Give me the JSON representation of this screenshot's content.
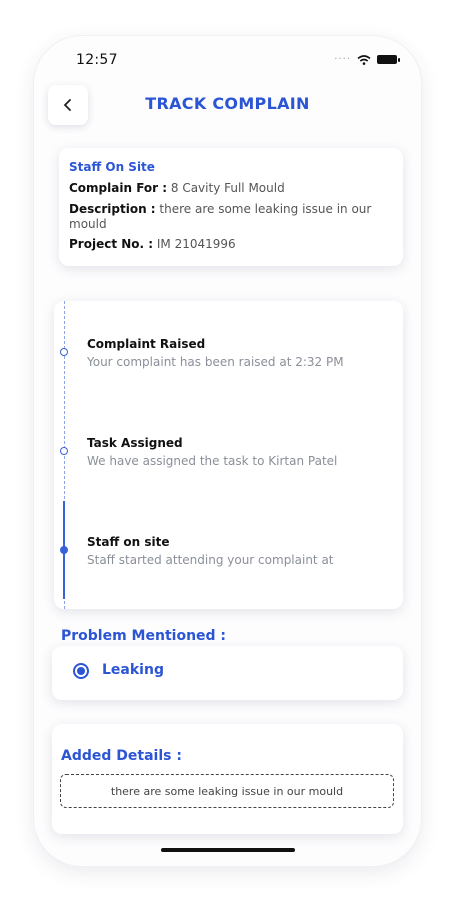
{
  "status_bar": {
    "time": "12:57"
  },
  "header": {
    "title": "TRACK COMPLAIN"
  },
  "info_card": {
    "site_label": "Staff On Site",
    "complain_for_label": "Complain For :",
    "complain_for_value": "8 Cavity Full Mould",
    "description_label": "Description :",
    "description_value": "there are some leaking issue in our mould",
    "project_label": "Project No. :",
    "project_value": "IM 21041996"
  },
  "timeline": [
    {
      "title": "Complaint Raised",
      "desc": "Your complaint has been raised at 2:32 PM"
    },
    {
      "title": "Task Assigned",
      "desc": "We have assigned the task to Kirtan Patel"
    },
    {
      "title": "Staff on site",
      "desc": "Staff started attending your complaint at"
    }
  ],
  "problem": {
    "label": "Problem Mentioned :",
    "option": "Leaking"
  },
  "details": {
    "label": "Added Details :",
    "text": "there are some leaking issue in our mould"
  },
  "colors": {
    "accent": "#2b55d4",
    "timeline": "#3a62d8"
  }
}
